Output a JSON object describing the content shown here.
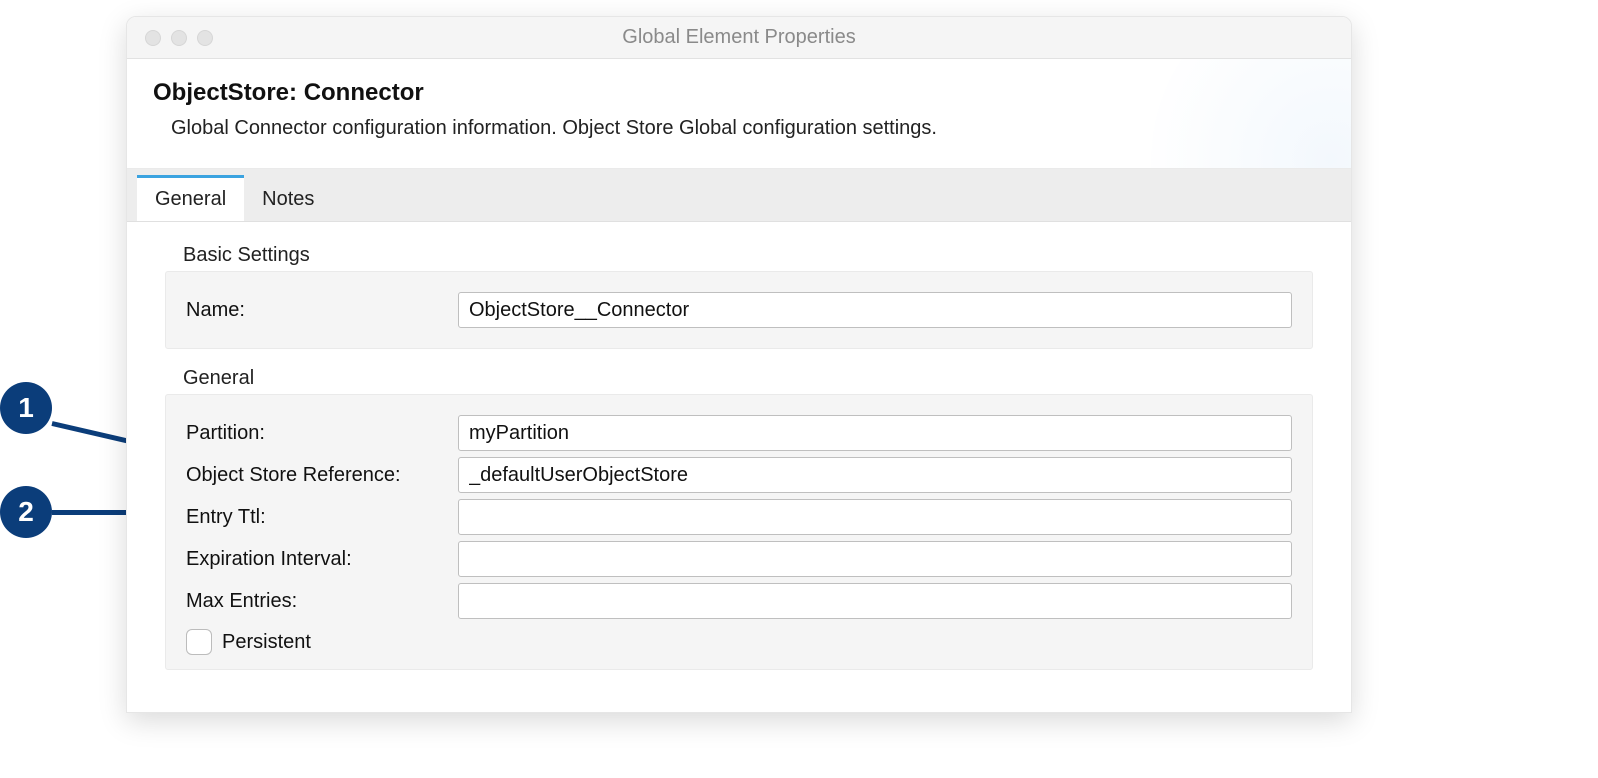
{
  "window": {
    "title": "Global Element Properties"
  },
  "header": {
    "title": "ObjectStore: Connector",
    "subtitle": "Global Connector configuration information. Object Store Global configuration settings."
  },
  "tabs": [
    {
      "label": "General",
      "active": true
    },
    {
      "label": "Notes",
      "active": false
    }
  ],
  "sections": {
    "basic": {
      "title": "Basic Settings",
      "fields": {
        "name": {
          "label": "Name:",
          "value": "ObjectStore__Connector"
        }
      }
    },
    "general": {
      "title": "General",
      "fields": {
        "partition": {
          "label": "Partition:",
          "value": "myPartition"
        },
        "objectStoreReference": {
          "label": "Object Store Reference:",
          "value": "_defaultUserObjectStore"
        },
        "entryTtl": {
          "label": "Entry Ttl:",
          "value": ""
        },
        "expirationInterval": {
          "label": "Expiration Interval:",
          "value": ""
        },
        "maxEntries": {
          "label": "Max Entries:",
          "value": ""
        },
        "persistent": {
          "label": "Persistent",
          "checked": false
        }
      }
    }
  },
  "callouts": [
    {
      "number": "1"
    },
    {
      "number": "2"
    }
  ]
}
